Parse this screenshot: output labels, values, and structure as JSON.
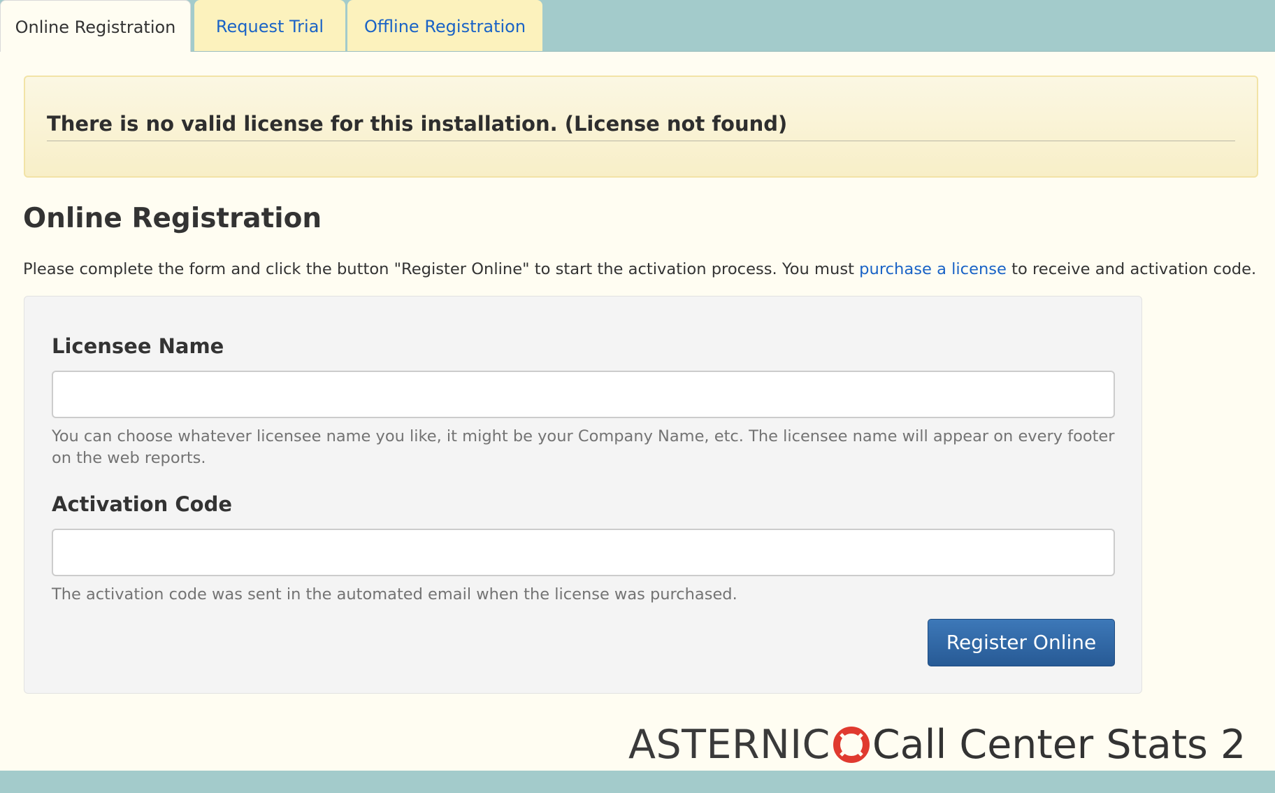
{
  "tabs": [
    {
      "label": "Online Registration"
    },
    {
      "label": "Request Trial"
    },
    {
      "label": "Offline Registration"
    }
  ],
  "alert": {
    "message": "There is no valid license for this installation. (License not found)"
  },
  "main": {
    "title": "Online Registration",
    "intro_before": "Please complete the form and click the button \"Register Online\" to start the activation process. You must ",
    "intro_link": "purchase a license",
    "intro_after": " to receive and activation code."
  },
  "form": {
    "licensee": {
      "label": "Licensee Name",
      "value": "",
      "help": "You can choose whatever licensee name you like, it might be your Company Name, etc. The licensee name will appear on every footer on the web reports."
    },
    "activation": {
      "label": "Activation Code",
      "value": "",
      "help": "The activation code was sent in the automated email when the license was purchased."
    },
    "submit_label": "Register Online"
  },
  "brand": {
    "name": "ASTERNIC",
    "product": "Call Center Stats 2",
    "icon": "lifebuoy-logo-icon"
  },
  "colors": {
    "tabbar": "#a3cbcb",
    "inactive_tab": "#fcf2bd",
    "link": "#1a63c6",
    "button": "#2f67a6",
    "alert_bg": "#f9f2d0"
  }
}
